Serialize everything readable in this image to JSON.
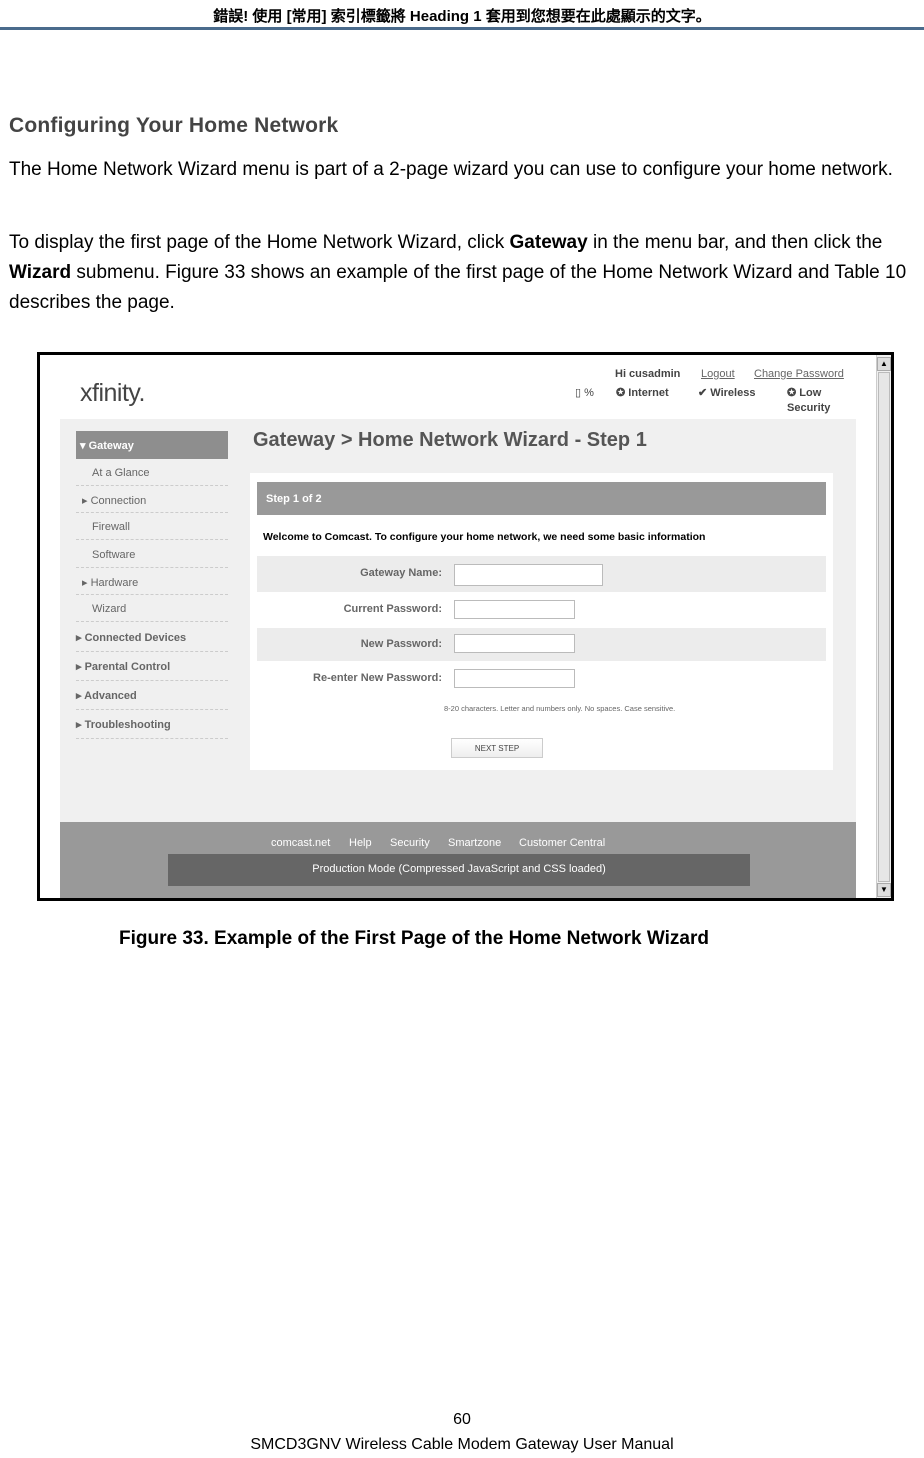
{
  "header": {
    "text": "錯誤! 使用 [常用] 索引標籤將 Heading 1 套用到您想要在此處顯示的文字。"
  },
  "section": {
    "title": "Configuring Your Home Network",
    "para1": "The Home Network Wizard menu is part of a 2-page wizard you can use to configure your home network.",
    "para2_a": "To display the first page of the Home Network Wizard, click ",
    "para2_b": "Gateway",
    "para2_c": " in the menu bar, and then click the ",
    "para2_d": "Wizard",
    "para2_e": " submenu. Figure 33 shows an example of the first page of the Home Network Wizard and Table 10 describes the page."
  },
  "screenshot": {
    "logo": "xfinity.",
    "user": "Hi cusadmin",
    "logout": "Logout",
    "change_password": "Change Password",
    "battery": "%",
    "status": [
      "Internet",
      "Wireless",
      "Low Security"
    ],
    "sidebar": {
      "active": "Gateway",
      "sub": [
        "At a Glance",
        "Connection",
        "Firewall",
        "Software",
        "Hardware",
        "Wizard"
      ],
      "main": [
        "Connected Devices",
        "Parental Control",
        "Advanced",
        "Troubleshooting"
      ]
    },
    "title": "Gateway > Home Network Wizard - Step 1",
    "step": "Step 1 of 2",
    "welcome": "Welcome to Comcast. To configure your home network, we need some basic information",
    "fields": [
      "Gateway Name:",
      "Current Password:",
      "New Password:",
      "Re-enter New Password:"
    ],
    "hint": "8-20 characters. Letter and numbers only. No spaces. Case sensitive.",
    "next": "NEXT STEP",
    "footer_links": [
      "comcast.net",
      "Help",
      "Security",
      "Smartzone",
      "Customer Central"
    ],
    "production": "Production Mode (Compressed JavaScript and CSS loaded)"
  },
  "caption": "Figure 33. Example of the First Page of the Home Network Wizard",
  "footer": {
    "page": "60",
    "manual": "SMCD3GNV Wireless Cable Modem Gateway User Manual"
  }
}
